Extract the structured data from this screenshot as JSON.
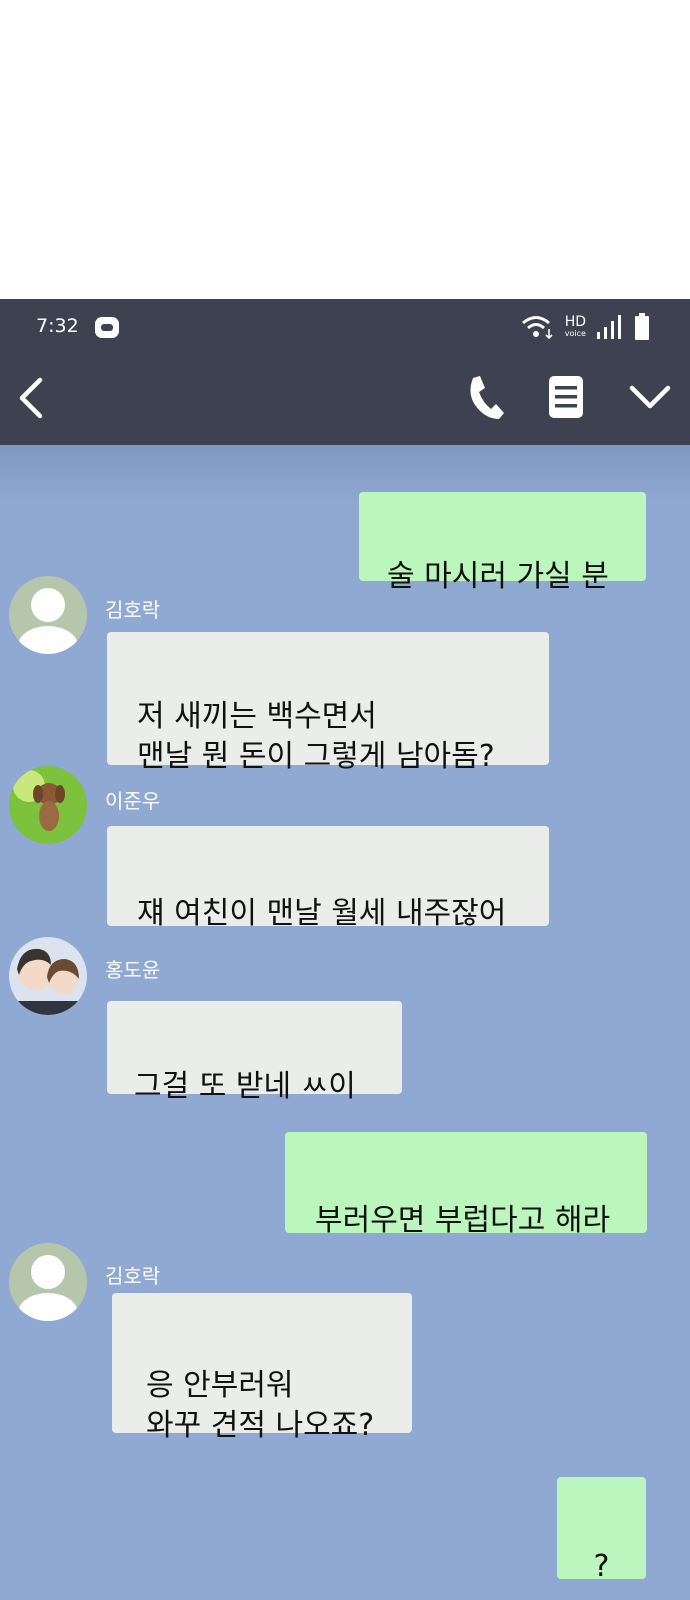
{
  "status_bar": {
    "time": "7:32",
    "hd_label": "HD",
    "voice_label": "voice"
  },
  "header": {
    "back": "chevron-left-icon",
    "call": "phone-icon",
    "menu": "menu-icon",
    "more": "chevron-down-icon"
  },
  "messages": [
    {
      "from": "me",
      "text": "술 마시러 가실 분"
    },
    {
      "from": "김호락",
      "name": "김호락",
      "text": "저 새끼는 백수면서\n맨날 뭔 돈이 그렇게 남아돔?"
    },
    {
      "from": "이준우",
      "name": "이준우",
      "text": "쟤 여친이 맨날 월세 내주잖어"
    },
    {
      "from": "홍도윤",
      "name": "홍도윤",
      "text": "그걸 또 받네 ㅆ이"
    },
    {
      "from": "me",
      "text": "부러우면 부럽다고 해라"
    },
    {
      "from": "김호락",
      "name": "김호락",
      "text": "응 안부러워\n와꾸 견적 나오죠?"
    },
    {
      "from": "me",
      "text": "?"
    }
  ],
  "colors": {
    "chat_bg": "#8fa9d2",
    "header_bg": "#3d4150",
    "my_bubble": "#bbf7bd",
    "their_bubble": "#ebedeb"
  }
}
